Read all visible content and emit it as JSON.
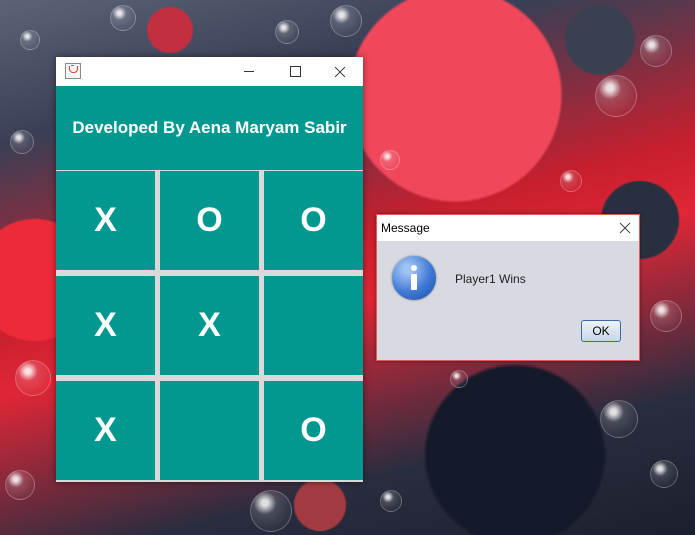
{
  "app_window": {
    "title": "",
    "header_text": "Developed By Aena Maryam Sabir",
    "header_color": "#029890",
    "board": [
      [
        "X",
        "O",
        "O"
      ],
      [
        "X",
        "X",
        ""
      ],
      [
        "X",
        "",
        "O"
      ]
    ]
  },
  "dialog": {
    "title": "Message",
    "message": "Player1 Wins",
    "ok_label": "OK",
    "icon": "information-icon"
  }
}
